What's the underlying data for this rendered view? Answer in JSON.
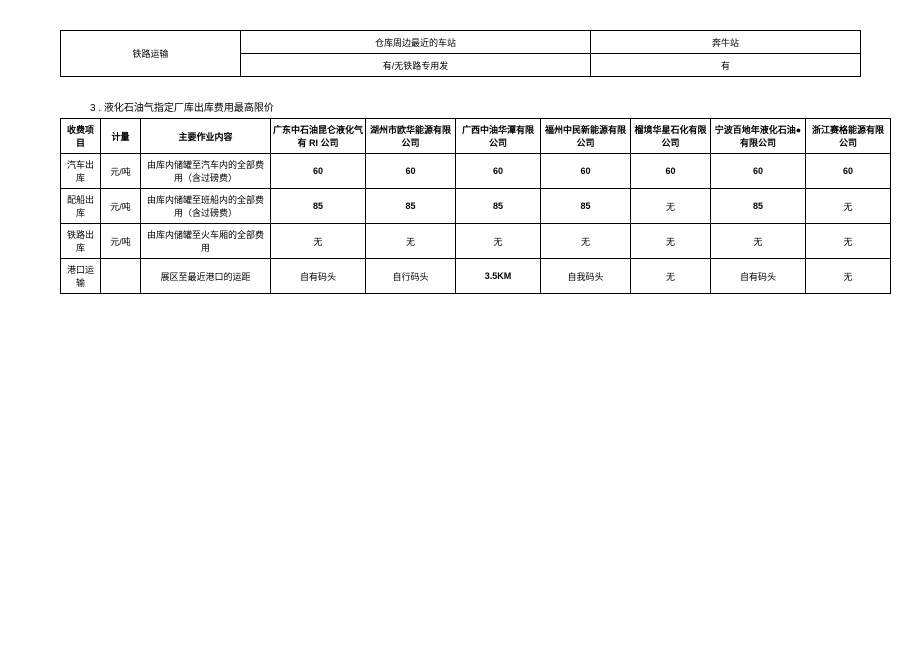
{
  "table1": {
    "col0": "铁路运输",
    "r0c1": "仓库周边最近的车站",
    "r0c2": "奔牛站",
    "r1c1": "有/无铁路专用发",
    "r1c2": "有"
  },
  "section_title": "3 . 液化石油气指定厂库出库费用最高限价",
  "table2": {
    "headers": {
      "h0": "收费项目",
      "h1": "计量",
      "h2": "主要作业内容",
      "h3": "广东中石油昆仑液化气有 RI 公司",
      "h4": "湖州市欧华能源有限公司",
      "h5": "广西中油华潭有限公司",
      "h6": "福州中民新能源有限公司",
      "h7": "榴境华星石化有限公司",
      "h8": "宁波百地年液化石油●有限公司",
      "h9": "浙江赛格能源有限公司"
    },
    "rows": [
      {
        "c0": "汽车出库",
        "c1": "元/吨",
        "c2": "由库内储罐至汽车内的全部费用（含过磅费）",
        "c3": "60",
        "c4": "60",
        "c5": "60",
        "c6": "60",
        "c7": "60",
        "c8": "60",
        "c9": "60",
        "boldVals": true
      },
      {
        "c0": "配船出库",
        "c1": "元/吨",
        "c2": "由库内储罐至班船内的全部费用（含过磅费）",
        "c3": "85",
        "c4": "85",
        "c5": "85",
        "c6": "85",
        "c7": "无",
        "c8": "85",
        "c9": "无",
        "boldVals": true
      },
      {
        "c0": "铁路出库",
        "c1": "元/吨",
        "c2": "由库内储罐至火车厢的全部费用",
        "c3": "无",
        "c4": "无",
        "c5": "无",
        "c6": "无",
        "c7": "无",
        "c8": "无",
        "c9": "无",
        "boldVals": false
      },
      {
        "c0": "港口运输",
        "c1": "",
        "c2": "展区至最近港口的运距",
        "c3": "自有码头",
        "c4": "自行码头",
        "c5": "3.5KM",
        "c6": "自我码头",
        "c7": "无",
        "c8": "自有码头",
        "c9": "无",
        "boldVals": false
      }
    ]
  }
}
